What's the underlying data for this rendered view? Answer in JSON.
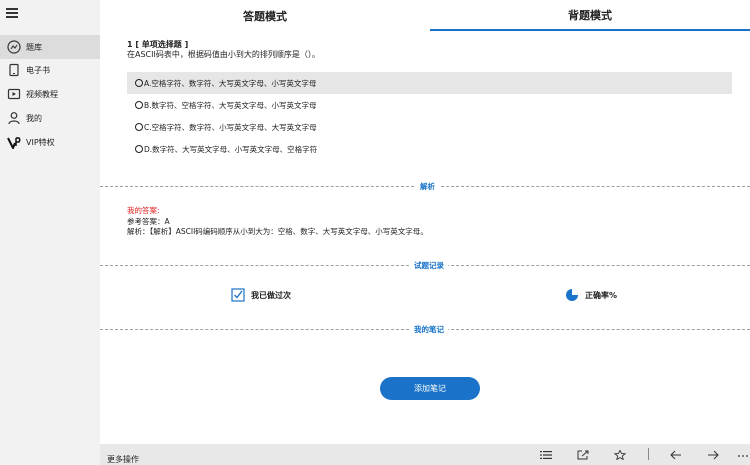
{
  "sidebar": {
    "items": [
      {
        "label": "题库",
        "icon": "question-bank-icon",
        "active": true
      },
      {
        "label": "电子书",
        "icon": "ebook-icon",
        "active": false
      },
      {
        "label": "视频教程",
        "icon": "video-icon",
        "active": false
      },
      {
        "label": "我的",
        "icon": "user-icon",
        "active": false
      },
      {
        "label": "VIP特权",
        "icon": "vip-icon",
        "active": false
      }
    ]
  },
  "tabs": {
    "answer_mode": "答题模式",
    "recite_mode": "背题模式"
  },
  "question": {
    "number": "1 [ 单项选择题 ]",
    "text": "在ASCII码表中，根据码值由小到大的排列顺序是（）。",
    "options": [
      "A.空格字符、数字符、大写英文字母、小写英文字母",
      "B.数字符、空格字符、大写英文字母、小写英文字母",
      "C.空格字符、数字符、小写英文字母、大写英文字母",
      "D.数字符、大写英文字母、小写英文字母、空格字符"
    ]
  },
  "analysis_section": {
    "title": "解析",
    "my_answer_label": "我的答案:",
    "reference_answer": "参考答案：A",
    "analysis_text": "解析：【解析】ASCII码编码顺序从小到大为：空格、数字、大写英文字母、小写英文字母。"
  },
  "record_section": {
    "title": "试题记录",
    "done_text": "我已做过次",
    "accuracy_text": "正确率%"
  },
  "notes_section": {
    "title": "我的笔记",
    "add_button": "添加笔记"
  },
  "bottombar": {
    "more_ops": "更多操作"
  },
  "colors": {
    "accent": "#1a73c8",
    "my_answer_red": "#e02020",
    "sidebar_bg": "#f2f2f2",
    "highlight_bg": "#e6e6e6"
  }
}
